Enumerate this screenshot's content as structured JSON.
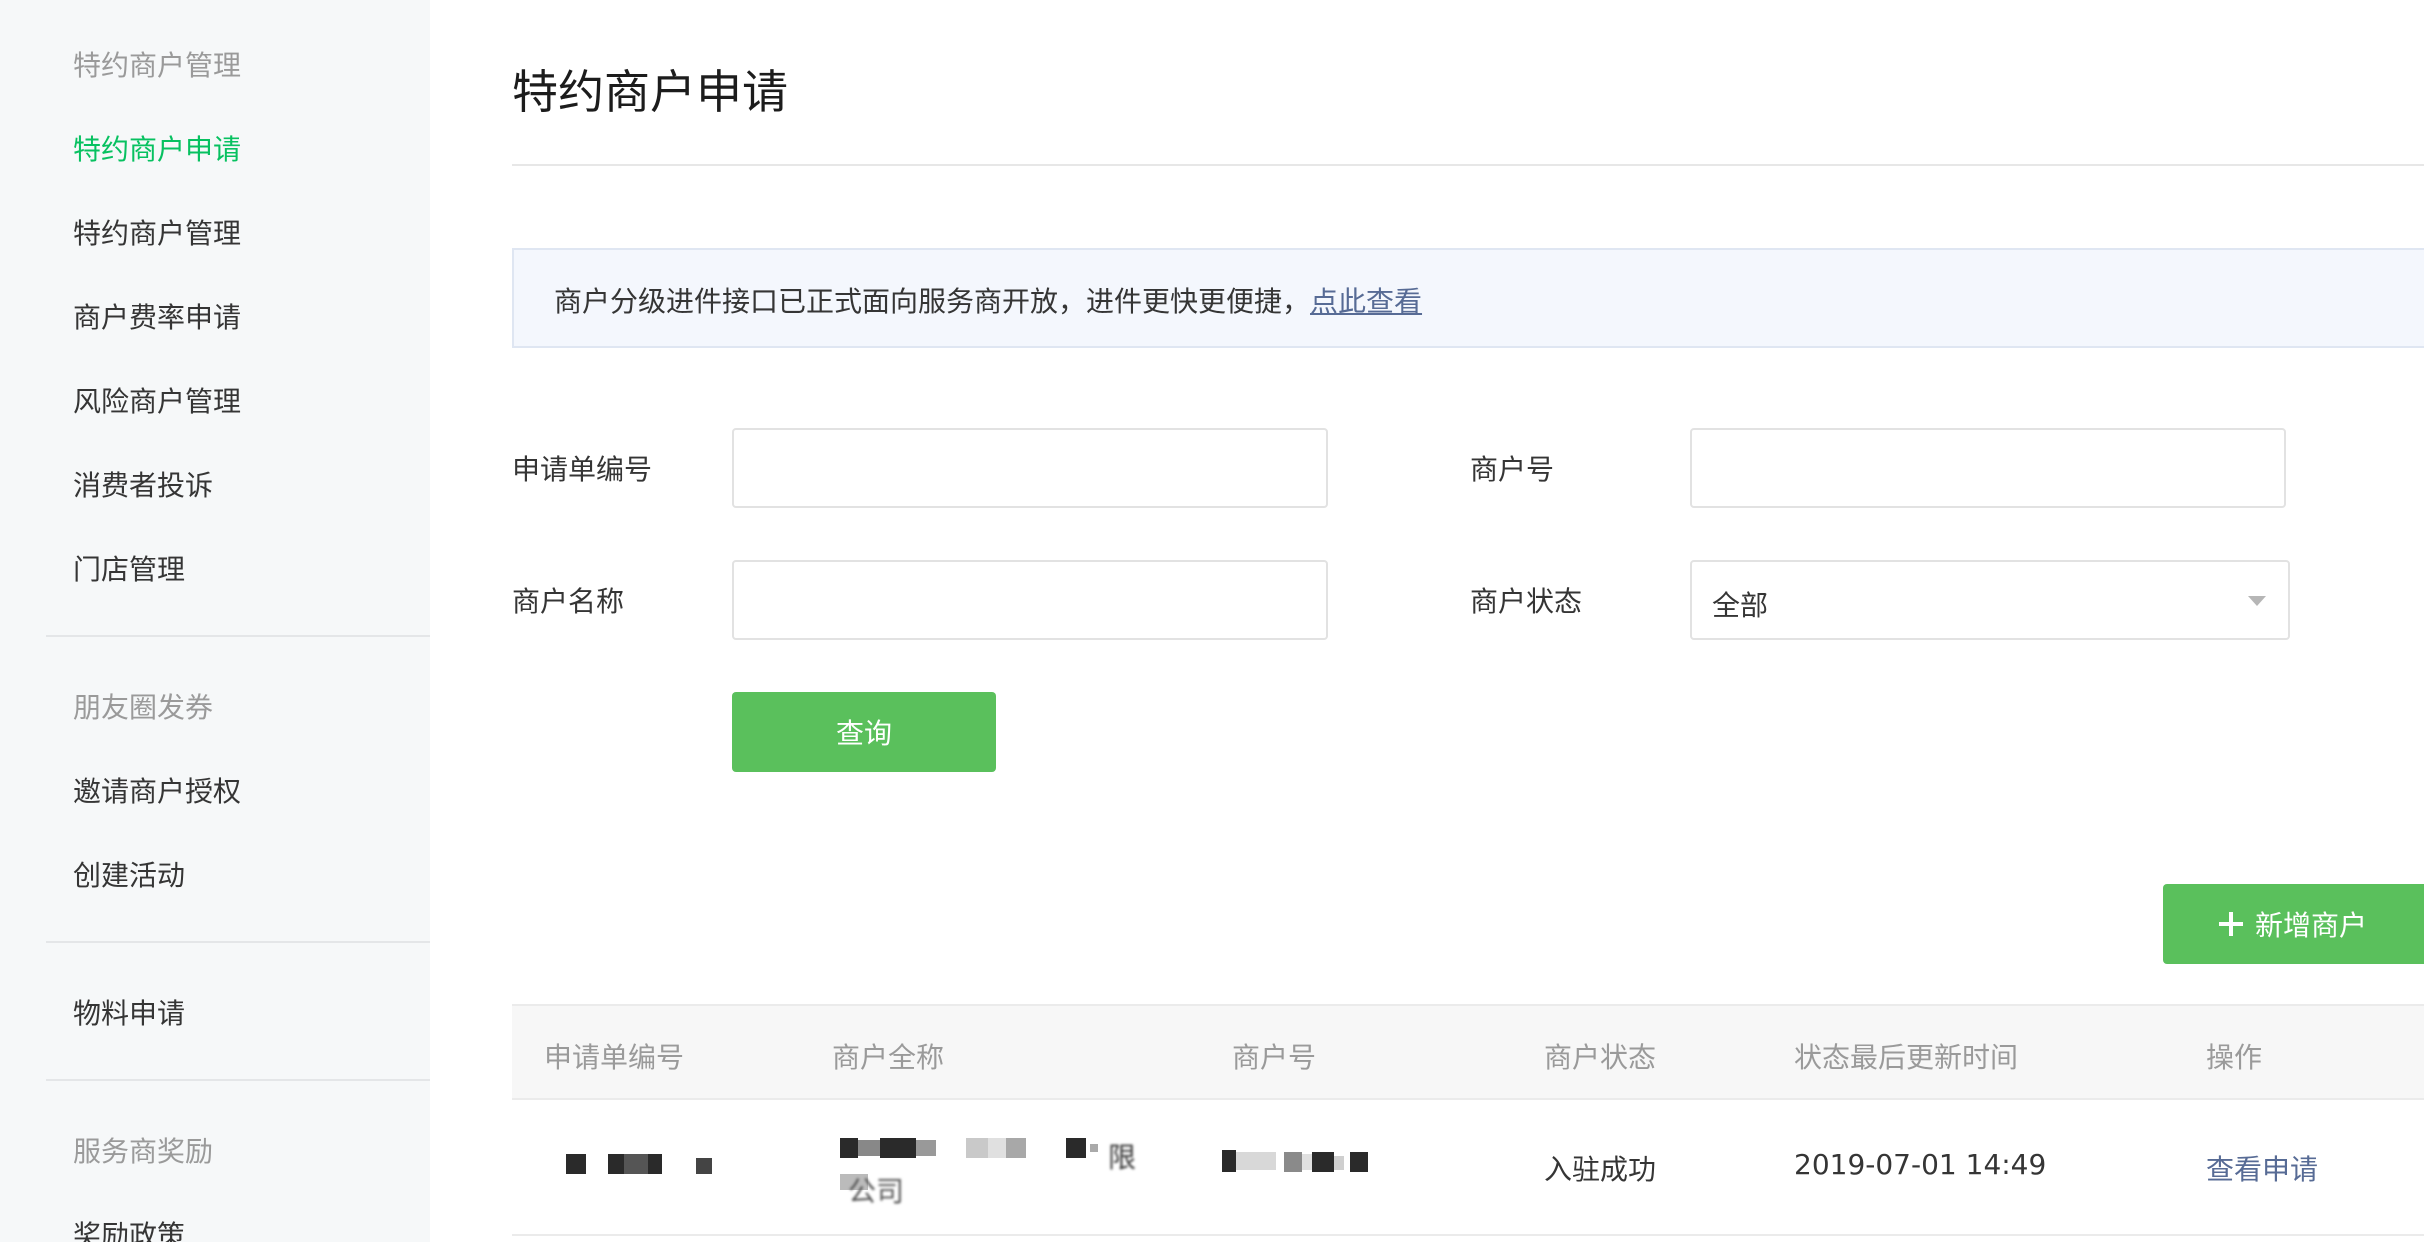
{
  "sidebar": {
    "groups": [
      {
        "title": "特约商户管理",
        "items": [
          "特约商户申请",
          "特约商户管理",
          "商户费率申请",
          "风险商户管理",
          "消费者投诉",
          "门店管理"
        ]
      },
      {
        "title": "朋友圈发券",
        "items": [
          "邀请商户授权",
          "创建活动"
        ]
      },
      {
        "title": "",
        "items": [
          "物料申请"
        ]
      },
      {
        "title": "服务商奖励",
        "items": [
          "奖励政策"
        ]
      }
    ],
    "active_item": "特约商户申请"
  },
  "page": {
    "title": "特约商户申请"
  },
  "notice": {
    "text": "商户分级进件接口已正式面向服务商开放，进件更快更便捷，",
    "link": "点此查看"
  },
  "form": {
    "application_no_label": "申请单编号",
    "application_no_value": "",
    "merchant_no_label": "商户号",
    "merchant_no_value": "",
    "merchant_name_label": "商户名称",
    "merchant_name_value": "",
    "merchant_status_label": "商户状态",
    "merchant_status_value": "全部",
    "query_button": "查询"
  },
  "actions": {
    "add_merchant": "新增商户"
  },
  "table": {
    "columns": [
      "申请单编号",
      "商户全称",
      "商户号",
      "商户状态",
      "状态最后更新时间",
      "操作"
    ],
    "rows": [
      {
        "application_no": "",
        "merchant_full_name_line1": "限",
        "merchant_full_name_line2": "公司",
        "merchant_no": "",
        "status": "入驻成功",
        "updated_at": "2019-07-01 14:49",
        "action": "查看申请"
      }
    ]
  },
  "colors": {
    "accent_green": "#07c160",
    "button_green": "#5ac05c",
    "link_blue": "#576b95"
  }
}
